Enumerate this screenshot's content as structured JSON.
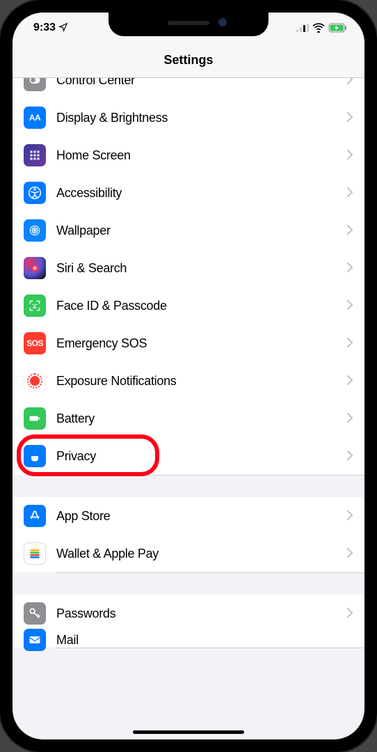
{
  "status_bar": {
    "time": "9:33",
    "location_arrow": "➤"
  },
  "header": {
    "title": "Settings"
  },
  "groups": [
    {
      "partial_top": true,
      "items": [
        {
          "icon": "control-center-icon",
          "bg": "bg-gray",
          "label": "Control Center",
          "name": "row-control-center"
        },
        {
          "icon": "display-icon",
          "bg": "bg-blue",
          "label": "Display & Brightness",
          "name": "row-display-brightness"
        },
        {
          "icon": "home-screen-icon",
          "bg": "bg-grid",
          "label": "Home Screen",
          "name": "row-home-screen"
        },
        {
          "icon": "accessibility-icon",
          "bg": "bg-blue",
          "label": "Accessibility",
          "name": "row-accessibility"
        },
        {
          "icon": "wallpaper-icon",
          "bg": "bg-cyan",
          "label": "Wallpaper",
          "name": "row-wallpaper"
        },
        {
          "icon": "siri-icon",
          "bg": "bg-siri",
          "label": "Siri & Search",
          "name": "row-siri-search"
        },
        {
          "icon": "faceid-icon",
          "bg": "bg-green",
          "label": "Face ID & Passcode",
          "name": "row-faceid-passcode"
        },
        {
          "icon": "sos-icon",
          "bg": "bg-red",
          "label": "Emergency SOS",
          "name": "row-emergency-sos"
        },
        {
          "icon": "exposure-icon",
          "bg": "exposure-icon",
          "label": "Exposure Notifications",
          "name": "row-exposure-notifications"
        },
        {
          "icon": "battery-row-icon",
          "bg": "bg-green",
          "label": "Battery",
          "name": "row-battery"
        },
        {
          "icon": "privacy-icon",
          "bg": "bg-blue",
          "label": "Privacy",
          "name": "row-privacy",
          "highlighted": true
        }
      ]
    },
    {
      "items": [
        {
          "icon": "appstore-icon",
          "bg": "bg-blue",
          "label": "App Store",
          "name": "row-app-store"
        },
        {
          "icon": "wallet-icon",
          "bg": "bg-white",
          "label": "Wallet & Apple Pay",
          "name": "row-wallet-apple-pay"
        }
      ]
    },
    {
      "items": [
        {
          "icon": "passwords-icon",
          "bg": "bg-key",
          "label": "Passwords",
          "name": "row-passwords"
        },
        {
          "icon": "mail-icon",
          "bg": "bg-blue",
          "label": "Mail",
          "name": "row-mail",
          "partial_bottom": true
        }
      ]
    }
  ],
  "icon_text": {
    "display-icon": "AA",
    "sos-icon": "SOS"
  }
}
